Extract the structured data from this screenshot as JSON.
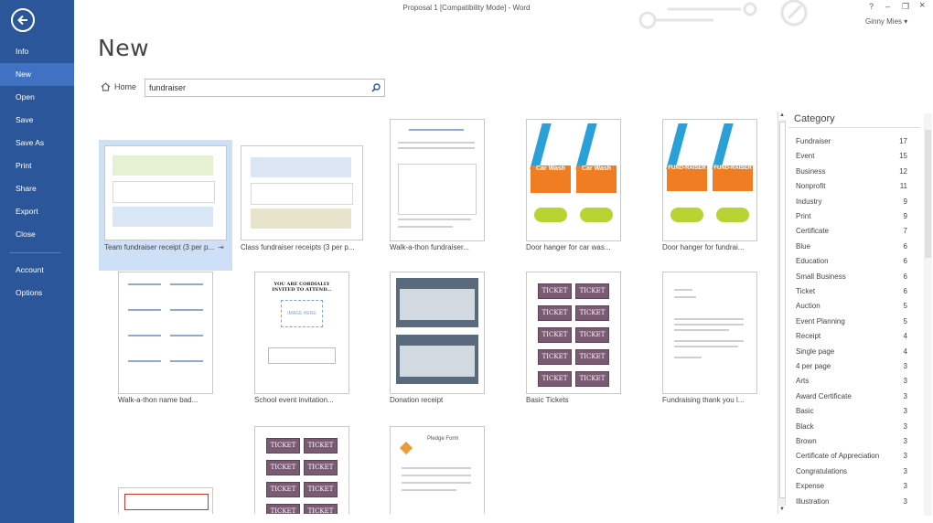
{
  "window": {
    "title": "Proposal 1 [Compatibility Mode] - Word",
    "help": "?",
    "minimize": "–",
    "restore": "❐",
    "close": "×",
    "user": "Ginny Mies"
  },
  "sidebar": {
    "items": [
      {
        "label": "Info"
      },
      {
        "label": "New",
        "active": true
      },
      {
        "label": "Open"
      },
      {
        "label": "Save"
      },
      {
        "label": "Save As"
      },
      {
        "label": "Print"
      },
      {
        "label": "Share"
      },
      {
        "label": "Export"
      },
      {
        "label": "Close"
      },
      {
        "label": "Account"
      },
      {
        "label": "Options"
      }
    ]
  },
  "main": {
    "title": "New",
    "home_label": "Home",
    "search_value": "fundraiser"
  },
  "templates": [
    {
      "label": "Team fundraiser receipt (3 per p..."
    },
    {
      "label": "Class fundraiser receipts (3 per p..."
    },
    {
      "label": "Walk-a-thon fundraiser..."
    },
    {
      "label": "Door hanger for car was..."
    },
    {
      "label": "Door hanger for fundrai..."
    },
    {
      "label": "Walk-a-thon name bad..."
    },
    {
      "label": "School event invitation..."
    },
    {
      "label": "Donation receipt"
    },
    {
      "label": "Basic Tickets"
    },
    {
      "label": "Fundraising thank you l..."
    }
  ],
  "thumb_text": {
    "car_wash": "Car Wash",
    "fundraiser": "Fundraiser",
    "fund_raiser": "FUND-RAISER",
    "ticket": "TICKET",
    "invite": "YOU ARE CORDIALLY INVITED TO ATTEND...",
    "image_here": "IMAGE HERE",
    "pledge_form": "Pledge Form"
  },
  "category": {
    "header": "Category",
    "items": [
      {
        "name": "Fundraiser",
        "count": "17"
      },
      {
        "name": "Event",
        "count": "15"
      },
      {
        "name": "Business",
        "count": "12"
      },
      {
        "name": "Nonprofit",
        "count": "11"
      },
      {
        "name": "Industry",
        "count": "9"
      },
      {
        "name": "Print",
        "count": "9"
      },
      {
        "name": "Certificate",
        "count": "7"
      },
      {
        "name": "Blue",
        "count": "6"
      },
      {
        "name": "Education",
        "count": "6"
      },
      {
        "name": "Small Business",
        "count": "6"
      },
      {
        "name": "Ticket",
        "count": "6"
      },
      {
        "name": "Auction",
        "count": "5"
      },
      {
        "name": "Event Planning",
        "count": "5"
      },
      {
        "name": "Receipt",
        "count": "4"
      },
      {
        "name": "Single page",
        "count": "4"
      },
      {
        "name": "4 per page",
        "count": "3"
      },
      {
        "name": "Arts",
        "count": "3"
      },
      {
        "name": "Award Certificate",
        "count": "3"
      },
      {
        "name": "Basic",
        "count": "3"
      },
      {
        "name": "Black",
        "count": "3"
      },
      {
        "name": "Brown",
        "count": "3"
      },
      {
        "name": "Certificate of Appreciation",
        "count": "3"
      },
      {
        "name": "Congratulations",
        "count": "3"
      },
      {
        "name": "Expense",
        "count": "3"
      },
      {
        "name": "Illustration",
        "count": "3"
      }
    ]
  },
  "colors": {
    "accent": "#2b579a",
    "selected": "#cde0f7",
    "ticket": "#7b5a74",
    "orange": "#f07d22"
  }
}
